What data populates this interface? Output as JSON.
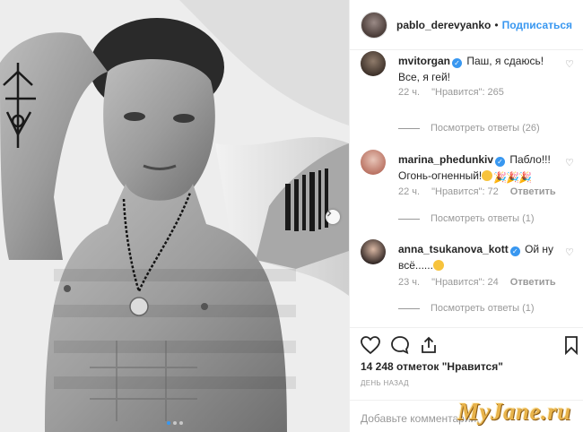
{
  "post": {
    "username": "pablo_derevyanko",
    "separator": "•",
    "follow_label": "Подписаться",
    "carousel": {
      "slides": 3,
      "active_index": 0
    },
    "likes_text": "14 248 отметок \"Нравится\"",
    "date_text": "ДЕНЬ НАЗАД",
    "add_comment_placeholder": "Добавьте комментарий..."
  },
  "comments": [
    {
      "username": "mvitorgan",
      "text": "Паш, я сдаюсь! Все, я гей!",
      "time": "22 ч.",
      "likes": "\"Нравится\": 265",
      "reply": "",
      "view_replies": "Посмотреть ответы (26)"
    },
    {
      "username": "marina_phedunkiv",
      "text_line1": "Пабло!!!",
      "text_line2": "Огонь-огненный!",
      "time": "22 ч.",
      "likes": "\"Нравится\": 72",
      "reply": "Ответить",
      "view_replies": "Посмотреть ответы (1)"
    },
    {
      "username": "anna_tsukanova_kott",
      "text": "Ой ну всё......",
      "time": "23 ч.",
      "likes": "\"Нравится\": 24",
      "reply": "Ответить",
      "view_replies": "Посмотреть ответы (1)"
    }
  ],
  "watermark": "MyJane.ru",
  "colors": {
    "accent": "#3897f0",
    "muted": "#999999",
    "text": "#262626",
    "watermark": "#e8b34a"
  }
}
